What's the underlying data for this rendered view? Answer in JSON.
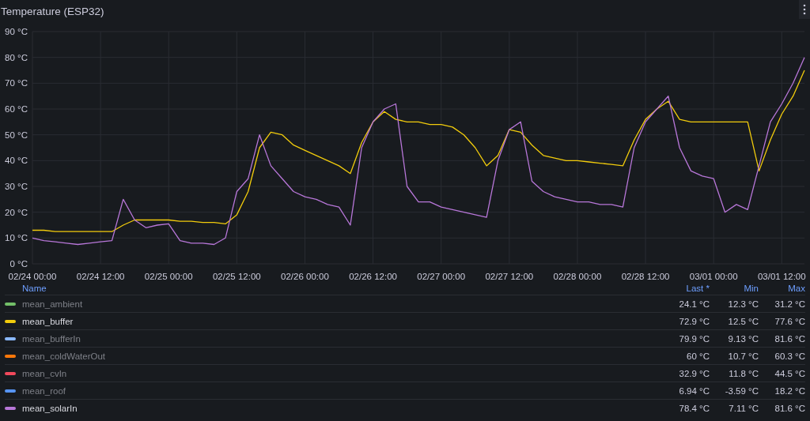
{
  "panel": {
    "title": "Temperature (ESP32)"
  },
  "chart_data": {
    "type": "line",
    "grid": true,
    "ylim": [
      0,
      90
    ],
    "yticks": [
      {
        "value": 0,
        "label": "0 °C"
      },
      {
        "value": 10,
        "label": "10 °C"
      },
      {
        "value": 20,
        "label": "20 °C"
      },
      {
        "value": 30,
        "label": "30 °C"
      },
      {
        "value": 40,
        "label": "40 °C"
      },
      {
        "value": 50,
        "label": "50 °C"
      },
      {
        "value": 60,
        "label": "60 °C"
      },
      {
        "value": 70,
        "label": "70 °C"
      },
      {
        "value": 80,
        "label": "80 °C"
      },
      {
        "value": 90,
        "label": "90 °C"
      }
    ],
    "categories": [
      "02/24 00:00",
      null,
      null,
      null,
      null,
      null,
      "02/24 12:00",
      null,
      null,
      null,
      null,
      null,
      "02/25 00:00",
      null,
      null,
      null,
      null,
      null,
      "02/25 12:00",
      null,
      null,
      null,
      null,
      null,
      "02/26 00:00",
      null,
      null,
      null,
      null,
      null,
      "02/26 12:00",
      null,
      null,
      null,
      null,
      null,
      "02/27 00:00",
      null,
      null,
      null,
      null,
      null,
      "02/27 12:00",
      null,
      null,
      null,
      null,
      null,
      "02/28 00:00",
      null,
      null,
      null,
      null,
      null,
      "02/28 12:00",
      null,
      null,
      null,
      null,
      null,
      "03/01 00:00",
      null,
      null,
      null,
      null,
      null,
      "03/01 12:00",
      null,
      null
    ],
    "series": [
      {
        "color": "#f2cc0c",
        "values": [
          13,
          13,
          12.5,
          12.5,
          12.5,
          12.5,
          12.5,
          12.5,
          15,
          17,
          17,
          17,
          17,
          16.5,
          16.5,
          16,
          16,
          15.5,
          19,
          28,
          45,
          51,
          50,
          46,
          44,
          42,
          40,
          38,
          35,
          47,
          55,
          59,
          56,
          55,
          55,
          54,
          54,
          53,
          50,
          45,
          38,
          42,
          52,
          51,
          46,
          42,
          41,
          40,
          40,
          39.5,
          39,
          38.5,
          38,
          48,
          56,
          60,
          63,
          56,
          55,
          55,
          55,
          55,
          55,
          55,
          36,
          48,
          58,
          65,
          75
        ]
      },
      {
        "color": "#b877d9",
        "values": [
          10,
          9,
          8.5,
          8,
          7.5,
          8,
          8.5,
          9,
          25,
          17,
          14,
          15,
          15.5,
          9,
          8,
          8,
          7.5,
          10,
          28,
          33,
          50,
          38,
          33,
          28,
          26,
          25,
          23,
          22,
          15,
          45,
          55,
          60,
          62,
          30,
          24,
          24,
          22,
          21,
          20,
          19,
          18,
          40,
          52,
          55,
          32,
          28,
          26,
          25,
          24,
          24,
          23,
          23,
          22,
          45,
          55,
          60,
          65,
          45,
          36,
          34,
          33,
          20,
          23,
          21,
          38,
          55,
          62,
          70,
          80
        ]
      }
    ]
  },
  "legend": {
    "columns": [
      "Name",
      "Last *",
      "Min",
      "Max"
    ],
    "rows": [
      {
        "name": "mean_ambient",
        "color": "#73bf69",
        "visible": false,
        "last": "24.1 °C",
        "min": "12.3 °C",
        "max": "31.2 °C"
      },
      {
        "name": "mean_buffer",
        "color": "#f2cc0c",
        "visible": true,
        "last": "72.9 °C",
        "min": "12.5 °C",
        "max": "77.6 °C"
      },
      {
        "name": "mean_bufferIn",
        "color": "#8ab8ff",
        "visible": false,
        "last": "79.9 °C",
        "min": "9.13 °C",
        "max": "81.6 °C"
      },
      {
        "name": "mean_coldWaterOut",
        "color": "#ff780a",
        "visible": false,
        "last": "60 °C",
        "min": "10.7 °C",
        "max": "60.3 °C"
      },
      {
        "name": "mean_cvIn",
        "color": "#f2495c",
        "visible": false,
        "last": "32.9 °C",
        "min": "11.8 °C",
        "max": "44.5 °C"
      },
      {
        "name": "mean_roof",
        "color": "#5794f2",
        "visible": false,
        "last": "6.94 °C",
        "min": "-3.59 °C",
        "max": "18.2 °C"
      },
      {
        "name": "mean_solarIn",
        "color": "#b877d9",
        "visible": true,
        "last": "78.4 °C",
        "min": "7.11 °C",
        "max": "81.6 °C"
      }
    ]
  }
}
